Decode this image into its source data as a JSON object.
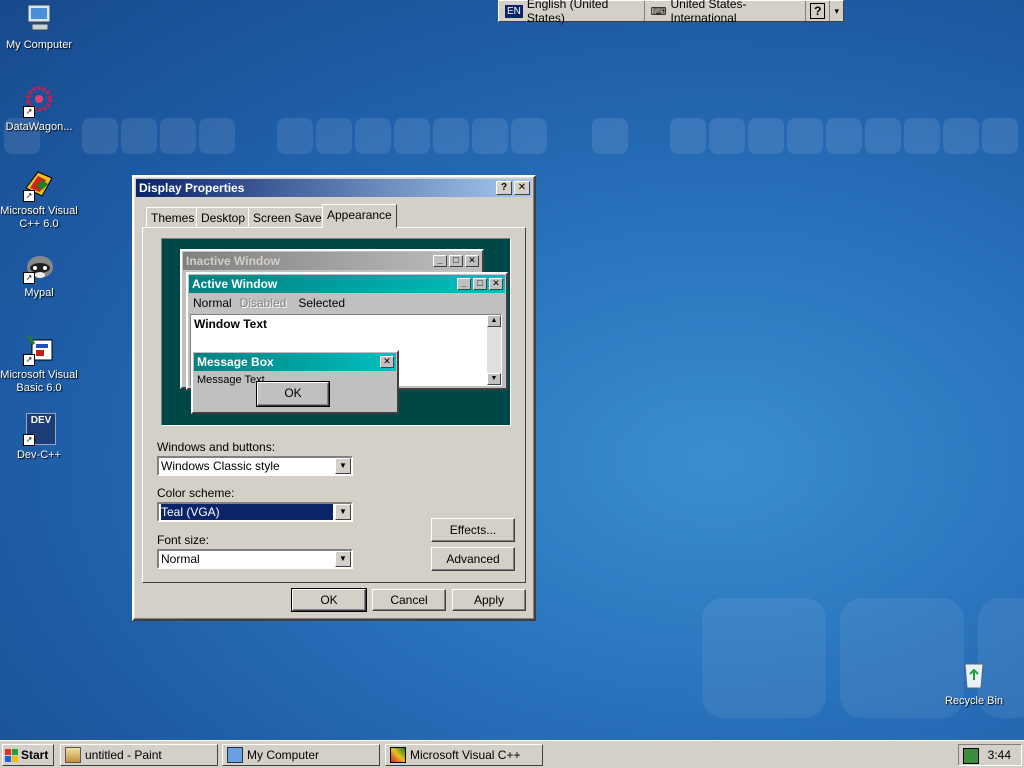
{
  "desktop": {
    "icons": [
      {
        "label": "My Computer",
        "icon": "my-computer-icon"
      },
      {
        "label": "DataWagon...",
        "icon": "datawagon-icon"
      },
      {
        "label": "Microsoft Visual C++ 6.0",
        "icon": "visual-cpp-icon"
      },
      {
        "label": "Mypal",
        "icon": "mypal-raccoon-icon"
      },
      {
        "label": "Microsoft Visual Basic 6.0",
        "icon": "visual-basic-icon"
      },
      {
        "label": "Dev-C++",
        "icon": "dev-cpp-icon"
      },
      {
        "label": "Recycle Bin",
        "icon": "recycle-bin-icon"
      }
    ],
    "dev_badge": "DEV"
  },
  "language_bar": {
    "lang_code": "EN",
    "language": "English (United States)",
    "keyboard": "United States-International",
    "help": "?"
  },
  "dialog": {
    "title": "Display Properties",
    "help_btn": "?",
    "close_btn": "✕",
    "tabs": [
      "Themes",
      "Desktop",
      "Screen Saver",
      "Appearance"
    ],
    "active_tab": "Appearance",
    "preview": {
      "inactive_title": "Inactive Window",
      "active_title": "Active Window",
      "menu_normal": "Normal",
      "menu_disabled": "Disabled",
      "menu_selected": "Selected",
      "window_text": "Window Text",
      "msgbox_title": "Message Box",
      "msgbox_text": "Message Text",
      "msgbox_ok": "OK"
    },
    "windows_buttons_label": "Windows and buttons:",
    "windows_buttons_value": "Windows Classic style",
    "color_scheme_label": "Color scheme:",
    "color_scheme_value": "Teal (VGA)",
    "font_size_label": "Font size:",
    "font_size_value": "Normal",
    "effects_button": "Effects...",
    "advanced_button": "Advanced",
    "ok_button": "OK",
    "cancel_button": "Cancel",
    "apply_button": "Apply"
  },
  "taskbar": {
    "start": "Start",
    "items": [
      "untitled - Paint",
      "My Computer",
      "Microsoft Visual C++"
    ],
    "clock": "3:44"
  },
  "colors": {
    "desktop": "#2a73bd",
    "titlebar_active": "#0a246a",
    "preview_bg": "#004848",
    "teal": "#008080"
  }
}
